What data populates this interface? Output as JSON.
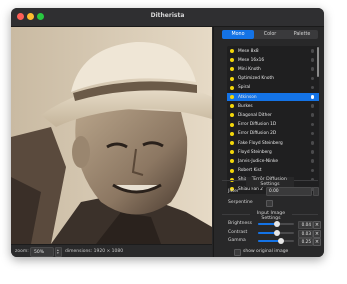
{
  "window": {
    "title": "Ditherista"
  },
  "tabs": [
    {
      "label": "Mono"
    },
    {
      "label": "Color"
    },
    {
      "label": "Palette"
    }
  ],
  "algorithms": [
    {
      "label": "Mese 8x8"
    },
    {
      "label": "Mese 16x16"
    },
    {
      "label": "Mini Knoth"
    },
    {
      "label": "Optimized Knoth"
    },
    {
      "label": "Spiral"
    },
    {
      "label": "Atkinson"
    },
    {
      "label": "Burkes"
    },
    {
      "label": "Diagonal Dither"
    },
    {
      "label": "Error Diffusion 1D"
    },
    {
      "label": "Error Diffusion 2D"
    },
    {
      "label": "Fake Floyd Steinberg"
    },
    {
      "label": "Floyd Steinberg"
    },
    {
      "label": "Jarvis-Judice-Ninke"
    },
    {
      "label": "Robert Kist"
    },
    {
      "label": "Shiau Fan 1"
    },
    {
      "label": "Shiau Fan 2"
    }
  ],
  "selected_algorithm": "Atkinson",
  "error_diffusion": {
    "title": "Error Diffusion Settings",
    "jitter_label": "Jitter",
    "jitter_value": "0.00",
    "serpentine_label": "Serpentine"
  },
  "input_settings": {
    "title": "Input Image Settings",
    "sliders": [
      {
        "label": "Brightness",
        "value": "0.04",
        "level": 0.52
      },
      {
        "label": "Contrast",
        "value": "0.03",
        "level": 0.515
      },
      {
        "label": "Gamma",
        "value": "0.25",
        "level": 0.625
      }
    ],
    "show_original_label": "show original image"
  },
  "statusbar": {
    "zoom_label": "zoom:",
    "zoom_value": "50%",
    "dimensions": "dimensions: 1920 × 1080"
  },
  "colors": {
    "accent": "#1473e6",
    "dot": "#f2d60a"
  }
}
